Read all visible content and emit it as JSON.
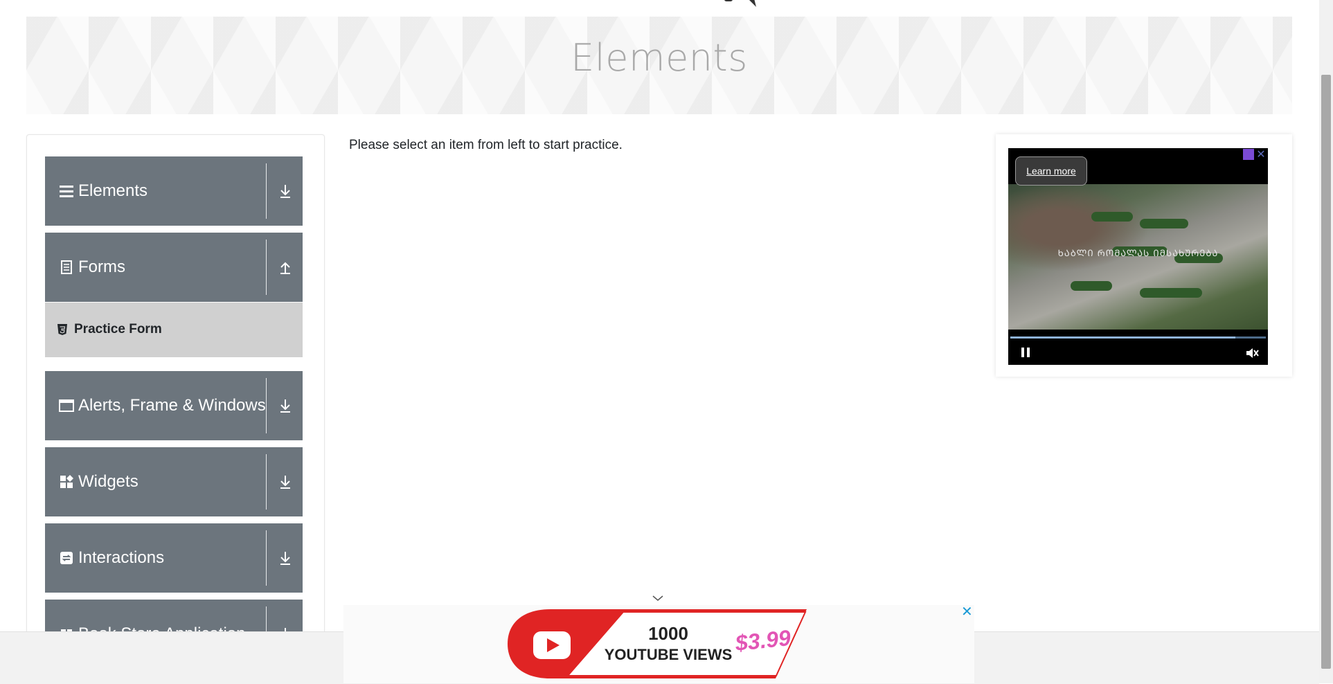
{
  "banner": {
    "title": "Elements"
  },
  "sidebar": {
    "groups": [
      {
        "label": "Elements",
        "icon": "list-icon",
        "state": "collapsed"
      },
      {
        "label": "Forms",
        "icon": "document-icon",
        "state": "expanded",
        "items": [
          {
            "label": "Practice Form",
            "icon": "html5-icon"
          }
        ]
      },
      {
        "label": "Alerts, Frame & Windows",
        "icon": "window-icon",
        "state": "collapsed"
      },
      {
        "label": "Widgets",
        "icon": "widgets-icon",
        "state": "collapsed"
      },
      {
        "label": "Interactions",
        "icon": "interactions-icon",
        "state": "collapsed"
      },
      {
        "label": "Book Store Application",
        "icon": "book-icon",
        "state": "collapsed"
      }
    ]
  },
  "main": {
    "message": "Please select an item from left to start practice."
  },
  "ad": {
    "learn_more": "Learn more",
    "caption": "ᲮᲐᲑᲚᲘ ᲠᲝᲛᲐᲚᲐᲡ ᲘᲛᲡᲐᲮᲣᲠᲔᲑᲐ",
    "progress": 0.88,
    "playing": true,
    "muted": true
  },
  "bottom_ad": {
    "line1": "1000",
    "line2": "YOUTUBE VIEWS",
    "price": "$3.99"
  },
  "colors": {
    "sidebar_group": "#6c757d",
    "sidebar_active_item": "#d0d0d0",
    "banner_title": "#a9a9a9",
    "youtube_red": "#e02424",
    "price_pink": "#e255b5"
  }
}
